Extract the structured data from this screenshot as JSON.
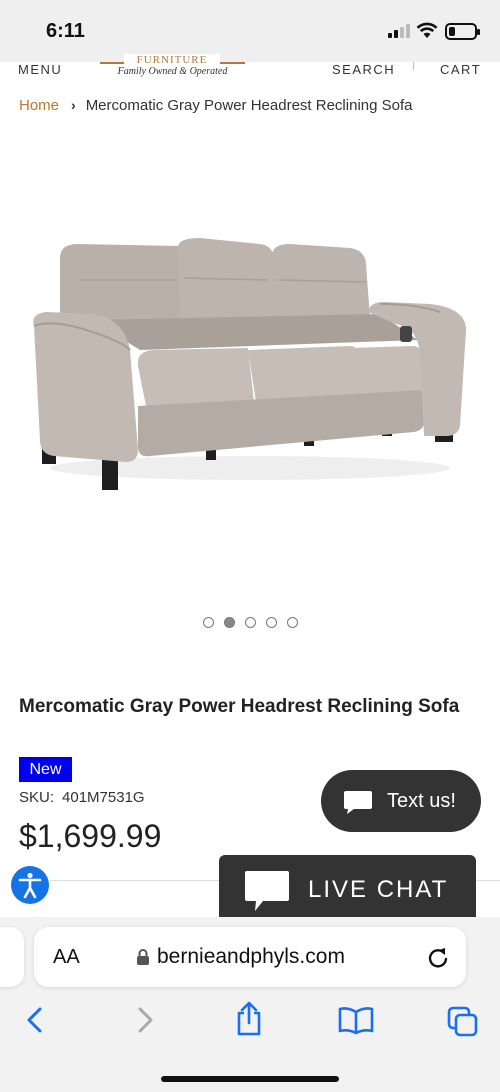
{
  "status_bar": {
    "time": "6:11"
  },
  "header": {
    "menu": "MENU",
    "logo_word": "FURNITURE",
    "logo_tagline": "Family Owned & Operated",
    "search": "SEARCH",
    "cart": "CART"
  },
  "breadcrumb": {
    "home": "Home",
    "separator": "›",
    "current": "Mercomatic Gray Power Headrest Reclining Sofa"
  },
  "gallery": {
    "image_alt": "product-photo-gray-reclining-sofa",
    "slide_count": 5,
    "active_slide": 2
  },
  "product": {
    "title": "Mercomatic Gray Power Headrest Reclining Sofa",
    "badge": "New",
    "sku_label": "SKU:",
    "sku_value": "401M7531G",
    "price": "$1,699.99"
  },
  "widgets": {
    "text_us": "Text us!",
    "live_chat": "LIVE CHAT"
  },
  "browser": {
    "aa_label": "AA",
    "domain": "bernieandphyls.com"
  },
  "colors": {
    "accent": "#c0772e",
    "badge": "#0000ee",
    "chat_bg": "#333333",
    "accessibility": "#1573e6",
    "ios_blue": "#1a6ff0"
  }
}
